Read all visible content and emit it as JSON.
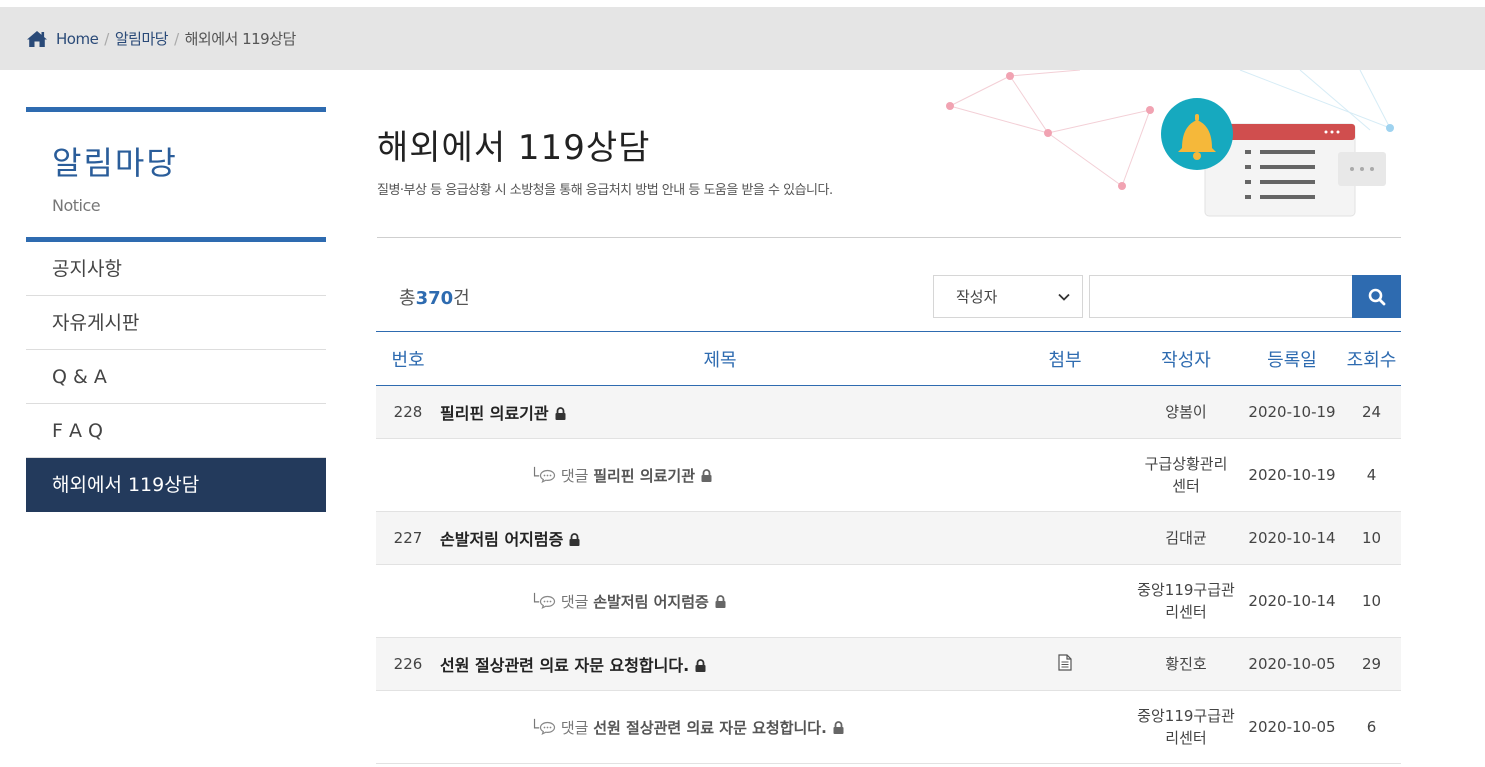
{
  "breadcrumb": {
    "home": "Home",
    "section": "알림마당",
    "current": "해외에서 119상담"
  },
  "sidebar": {
    "title": "알림마당",
    "subtitle": "Notice",
    "items": [
      {
        "label": "공지사항"
      },
      {
        "label": "자유게시판"
      },
      {
        "label": "Q & A"
      },
      {
        "label": "F A Q"
      },
      {
        "label": "해외에서 119상담"
      }
    ]
  },
  "page": {
    "title": "해외에서 119상담",
    "description": "질병·부상 등 응급상황 시 소방청을 통해 응급처치 방법 안내 등 도움을 받을 수 있습니다."
  },
  "board": {
    "total_prefix": "총",
    "total_count": "370",
    "total_suffix": "건",
    "search_select": "작성자",
    "search_placeholder": "",
    "columns": [
      "번호",
      "제목",
      "첨부",
      "작성자",
      "등록일",
      "조회수"
    ],
    "reply_prefix": "댓글",
    "rows": [
      {
        "type": "post",
        "no": "228",
        "title": "필리핀 의료기관",
        "attach": false,
        "writer": "양봄이",
        "date": "2020-10-19",
        "views": "24"
      },
      {
        "type": "reply",
        "no": "",
        "title": "필리핀 의료기관",
        "attach": false,
        "writer": "구급상황관리센터",
        "writer_line1": "구급상황관리",
        "writer_line2": "센터",
        "date": "2020-10-19",
        "views": "4"
      },
      {
        "type": "post",
        "no": "227",
        "title": "손발저림 어지럼증",
        "attach": false,
        "writer": "김대균",
        "date": "2020-10-14",
        "views": "10"
      },
      {
        "type": "reply",
        "no": "",
        "title": "손발저림 어지럼증",
        "attach": false,
        "writer": "중앙119구급관리센터",
        "writer_line1": "중앙119구급관",
        "writer_line2": "리센터",
        "date": "2020-10-14",
        "views": "10"
      },
      {
        "type": "post",
        "no": "226",
        "title": "선원 절상관련 의료 자문 요청합니다.",
        "attach": true,
        "writer": "황진호",
        "date": "2020-10-05",
        "views": "29"
      },
      {
        "type": "reply",
        "no": "",
        "title": "선원 절상관련 의료 자문 요청합니다.",
        "attach": false,
        "writer": "중앙119구급관리센터",
        "writer_line1": "중앙119구급관",
        "writer_line2": "리센터",
        "date": "2020-10-05",
        "views": "6"
      }
    ]
  },
  "colors": {
    "accent": "#2e6bb0",
    "sidebar_active": "#233a5c",
    "breadcrumb_bg": "#e5e5e5"
  },
  "icons": {
    "home": "home-icon",
    "search": "search-icon",
    "lock": "lock-icon",
    "attachment": "attachment-file-icon",
    "reply": "speech-bubble-icon"
  }
}
